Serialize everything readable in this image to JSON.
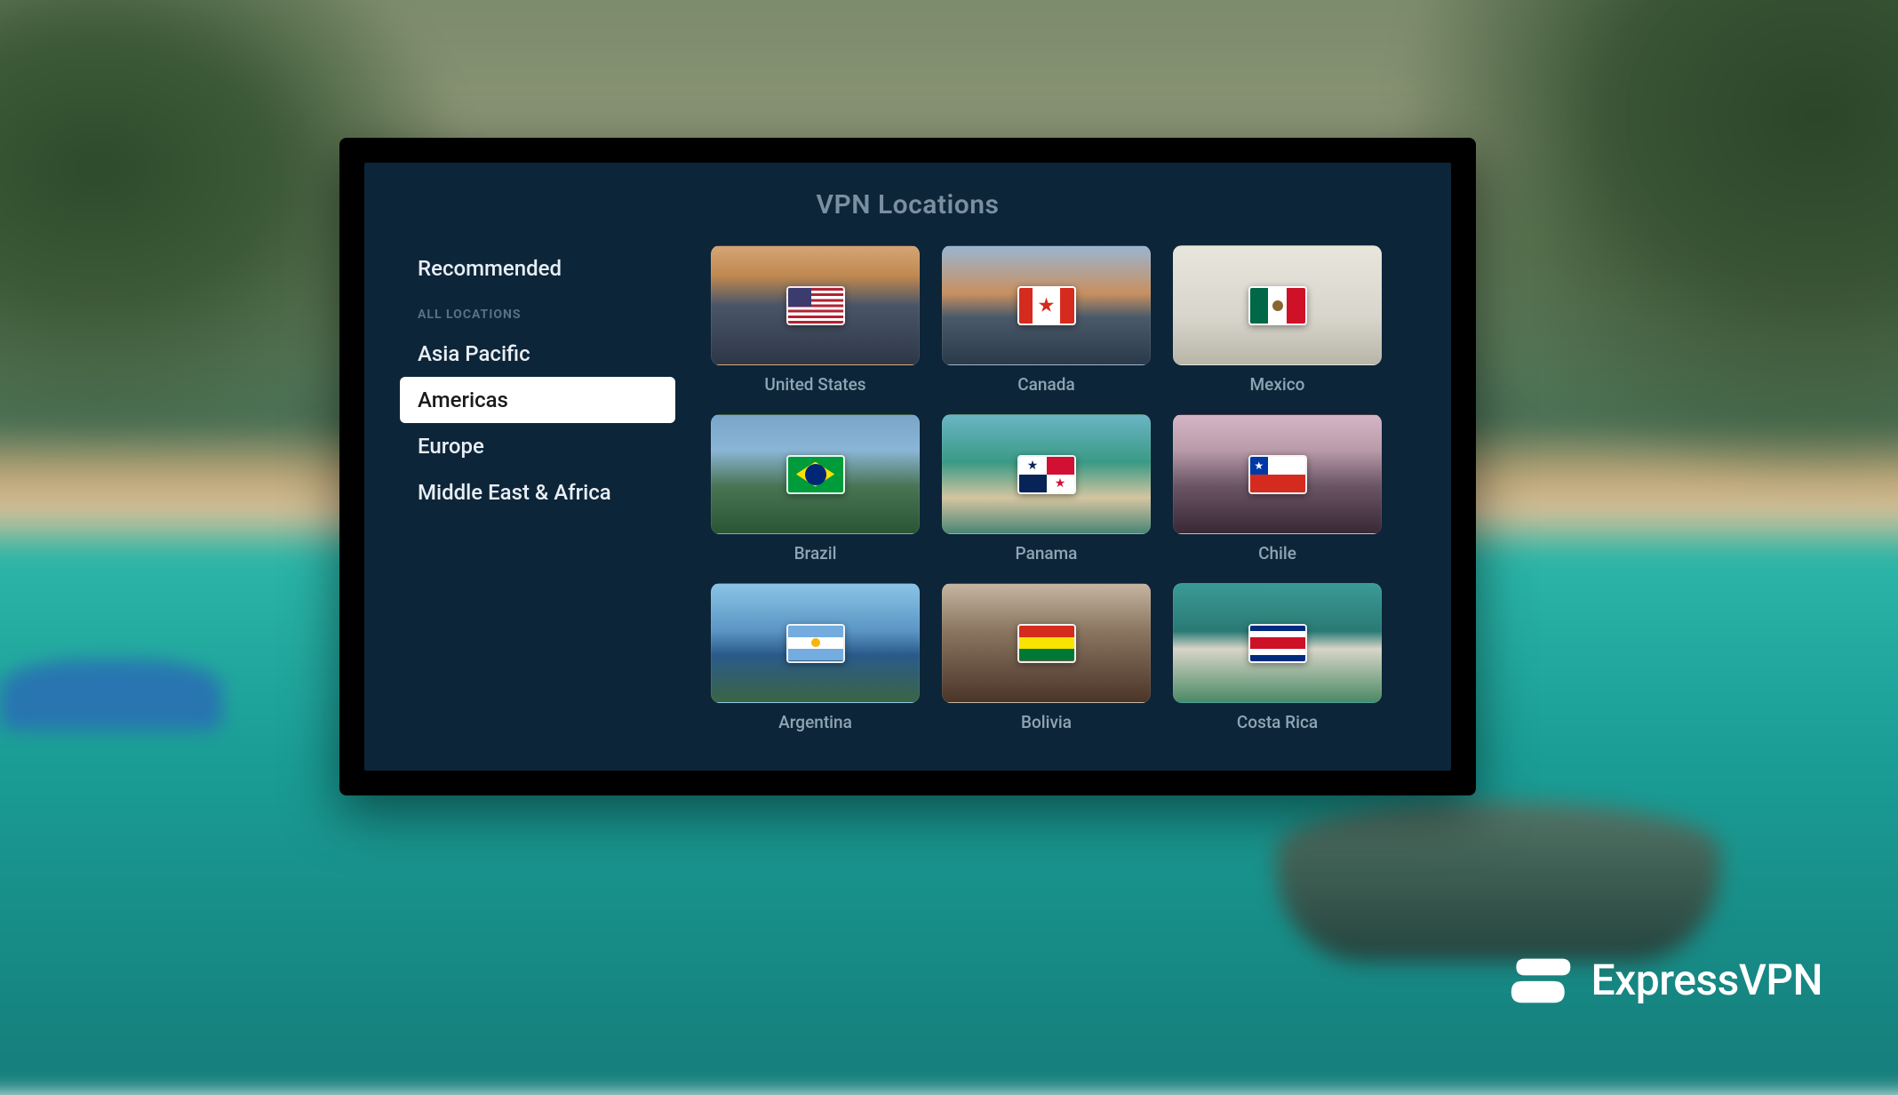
{
  "title": "VPN Locations",
  "brand": "ExpressVPN",
  "sidebar": {
    "recommended": "Recommended",
    "all_locations_header": "ALL LOCATIONS",
    "items": [
      {
        "label": "Asia Pacific",
        "selected": false
      },
      {
        "label": "Americas",
        "selected": true
      },
      {
        "label": "Europe",
        "selected": false
      },
      {
        "label": "Middle East & Africa",
        "selected": false
      }
    ]
  },
  "locations": [
    {
      "name": "United States",
      "code": "us"
    },
    {
      "name": "Canada",
      "code": "ca"
    },
    {
      "name": "Mexico",
      "code": "mx"
    },
    {
      "name": "Brazil",
      "code": "br"
    },
    {
      "name": "Panama",
      "code": "pa"
    },
    {
      "name": "Chile",
      "code": "cl"
    },
    {
      "name": "Argentina",
      "code": "ar"
    },
    {
      "name": "Bolivia",
      "code": "bo"
    },
    {
      "name": "Costa Rica",
      "code": "cr"
    }
  ]
}
